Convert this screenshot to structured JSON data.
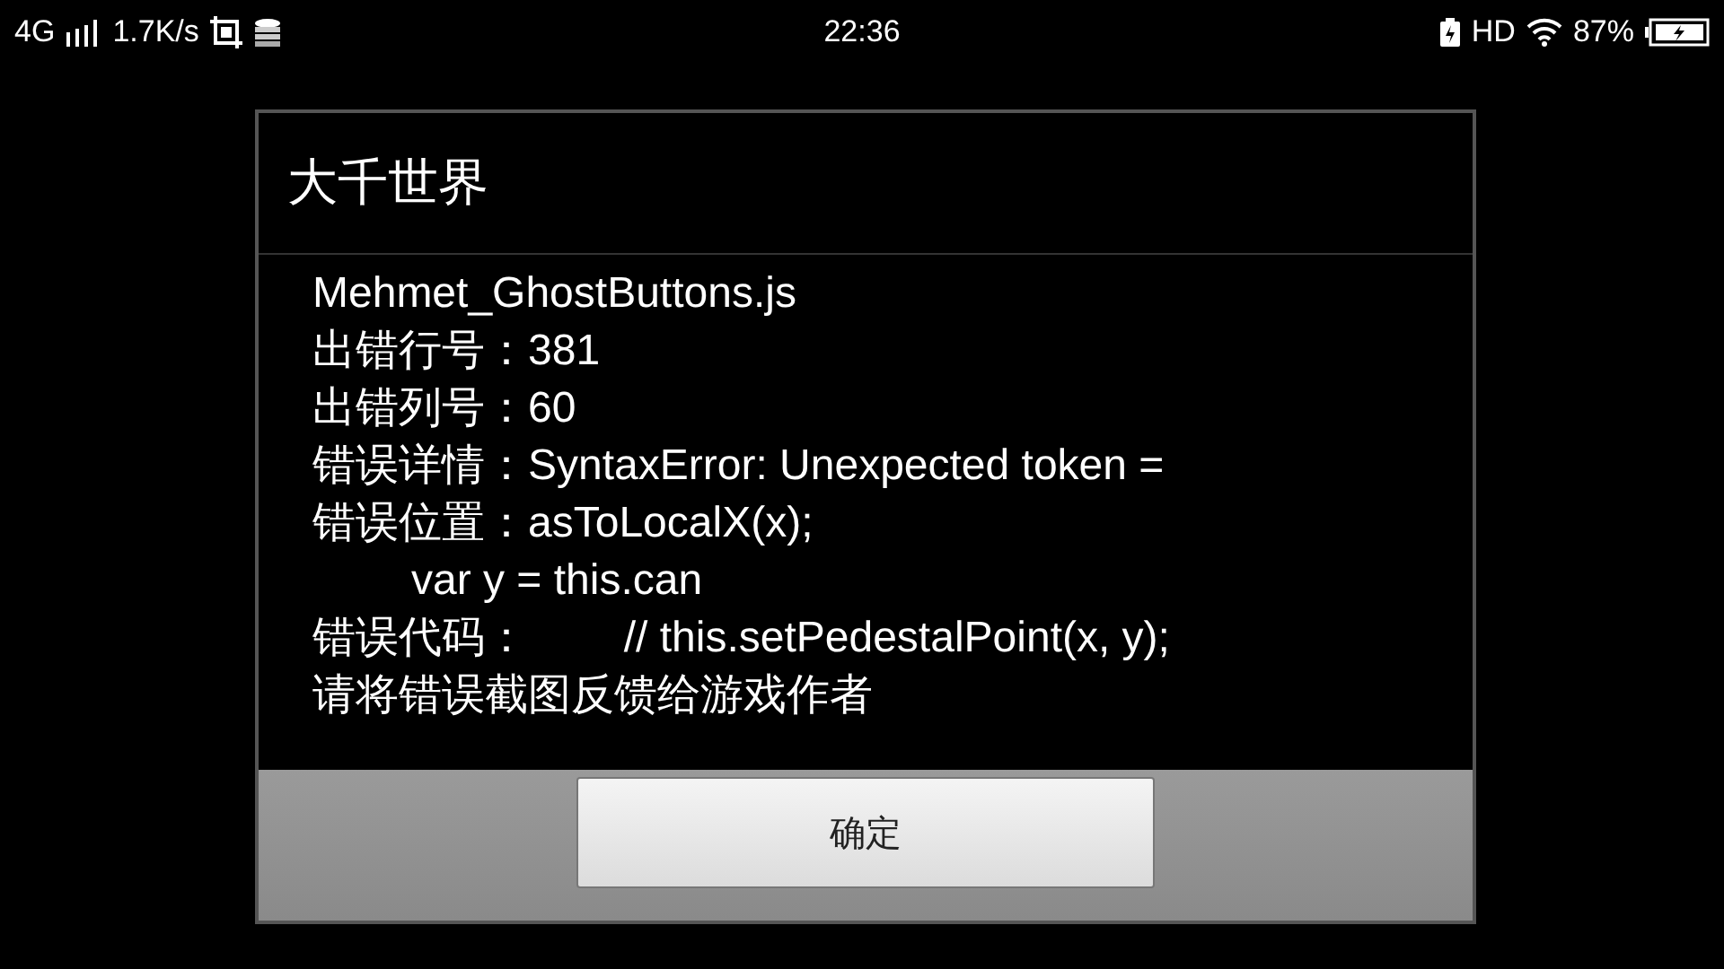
{
  "status_bar": {
    "network": "4G",
    "speed": "1.7K/s",
    "time": "22:36",
    "hd": "HD",
    "battery": "87%"
  },
  "dialog": {
    "title": "大千世界",
    "lines": [
      {
        "text": "Mehmet_GhostButtons.js",
        "indent": false
      },
      {
        "text": "出错行号：381",
        "indent": false
      },
      {
        "text": "出错列号：60",
        "indent": false
      },
      {
        "text": "错误详情：SyntaxError: Unexpected token =",
        "indent": false
      },
      {
        "text": "错误位置：asToLocalX(x);",
        "indent": false
      },
      {
        "text": "var y = this.can",
        "indent": true
      },
      {
        "text": "错误代码：        // this.setPedestalPoint(x, y);",
        "indent": false
      },
      {
        "text": "请将错误截图反馈给游戏作者",
        "indent": false
      }
    ],
    "buttons": [
      "确定"
    ]
  }
}
